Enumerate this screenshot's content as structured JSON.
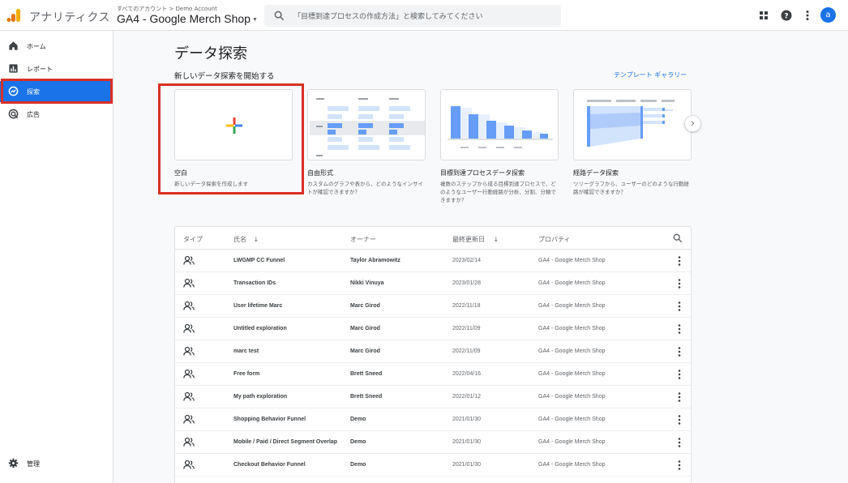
{
  "header": {
    "app_title": "アナリティクス",
    "breadcrumb": "すべてのアカウント > Demo Account",
    "property": "GA4 - Google Merch Shop",
    "search_placeholder": "「目標到達プロセスの作成方法」と検索してみてください",
    "avatar_letter": "a"
  },
  "sidebar": {
    "items": [
      {
        "label": "ホーム",
        "icon": "home-icon"
      },
      {
        "label": "レポート",
        "icon": "reports-icon"
      },
      {
        "label": "探索",
        "icon": "explore-icon",
        "active": true
      },
      {
        "label": "広告",
        "icon": "advertising-icon"
      }
    ],
    "admin_label": "管理"
  },
  "main": {
    "title": "データ探索",
    "section_title": "新しいデータ探索を開始する",
    "gallery_link": "テンプレート ギャラリー",
    "cards": [
      {
        "title": "空白",
        "description": "新しいデータ探索を作成します"
      },
      {
        "title": "自由形式",
        "description": "カスタムのグラフや表から、どのようなインサイトが確認できますか？"
      },
      {
        "title": "目標到達プロセスデータ探索",
        "description": "複数のステップから成る目標到達プロセスで、どのようなユーザー行動経路が分析、分割、分類できますか？"
      },
      {
        "title": "経路データ探索",
        "description": "ツリーグラフから、ユーザーのどのような行動経路が確認できますか？"
      }
    ]
  },
  "table": {
    "headers": {
      "type": "タイプ",
      "name": "氏名",
      "owner": "オーナー",
      "modified": "最終更新日",
      "property": "プロパティ"
    },
    "rows": [
      {
        "name": "LWGMP CC Funnel",
        "owner": "Taylor Abramowitz",
        "date": "2023/02/14",
        "property": "GA4 - Google Merch Shop"
      },
      {
        "name": "Transaction IDs",
        "owner": "Nikki Vinuya",
        "date": "2023/01/28",
        "property": "GA4 - Google Merch Shop"
      },
      {
        "name": "User lifetime Marc",
        "owner": "Marc Girod",
        "date": "2022/11/18",
        "property": "GA4 - Google Merch Shop"
      },
      {
        "name": "Untitled exploration",
        "owner": "Marc Girod",
        "date": "2022/11/09",
        "property": "GA4 - Google Merch Shop"
      },
      {
        "name": "marc test",
        "owner": "Marc Girod",
        "date": "2022/11/09",
        "property": "GA4 - Google Merch Shop"
      },
      {
        "name": "Free form",
        "owner": "Brett Sneed",
        "date": "2022/04/16",
        "property": "GA4 - Google Merch Shop"
      },
      {
        "name": "My path exploration",
        "owner": "Brett Sneed",
        "date": "2022/01/12",
        "property": "GA4 - Google Merch Shop"
      },
      {
        "name": "Shopping Behavior Funnel",
        "owner": "Demo",
        "date": "2021/01/30",
        "property": "GA4 - Google Merch Shop"
      },
      {
        "name": "Mobile / Paid / Direct Segment Overlap",
        "owner": "Demo",
        "date": "2021/01/30",
        "property": "GA4 - Google Merch Shop"
      },
      {
        "name": "Checkout Behavior Funnel",
        "owner": "Demo",
        "date": "2021/01/30",
        "property": "GA4 - Google Merch Shop"
      }
    ]
  },
  "colors": {
    "accent": "#1a73e8",
    "highlight": "#d93025",
    "logo_orange": "#f9ab00",
    "logo_dark": "#e37400"
  }
}
